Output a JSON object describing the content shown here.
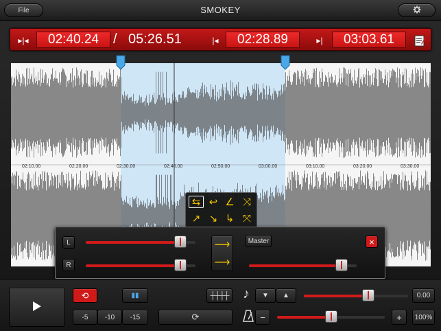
{
  "app": {
    "title": "SMOKEY",
    "file_label": "File",
    "settings_icon": "gear-icon"
  },
  "timebar": {
    "position": "02:40.24",
    "separator": "/",
    "duration": "05:26.51",
    "loop_start": "02:28.89",
    "loop_end": "03:03.61"
  },
  "waveform": {
    "ruler": [
      "02:10.00",
      "02:20.00",
      "02:30.00",
      "02:40.00",
      "02:50.00",
      "03:00.00",
      "03:10.00",
      "03:20.00",
      "03:30.00"
    ],
    "selection_color": "#cfe6f7",
    "wave_color": "#555555"
  },
  "mixer": {
    "left_label": "L",
    "right_label": "R",
    "left_level": 0.86,
    "right_level": 0.86,
    "master_label": "Master",
    "master_level": 0.86,
    "close_symbol": "×"
  },
  "transport": {
    "skip": [
      "-5",
      "-10",
      "-15"
    ],
    "pitch_value": "0.00",
    "pitch_level": 0.62,
    "tempo_value": "100%",
    "tempo_level": 0.5,
    "minus": "−",
    "plus": "+"
  },
  "colors": {
    "accent_red": "#d01a1a",
    "marker_blue": "#4aa8e8",
    "fx_yellow": "#f0c000"
  }
}
